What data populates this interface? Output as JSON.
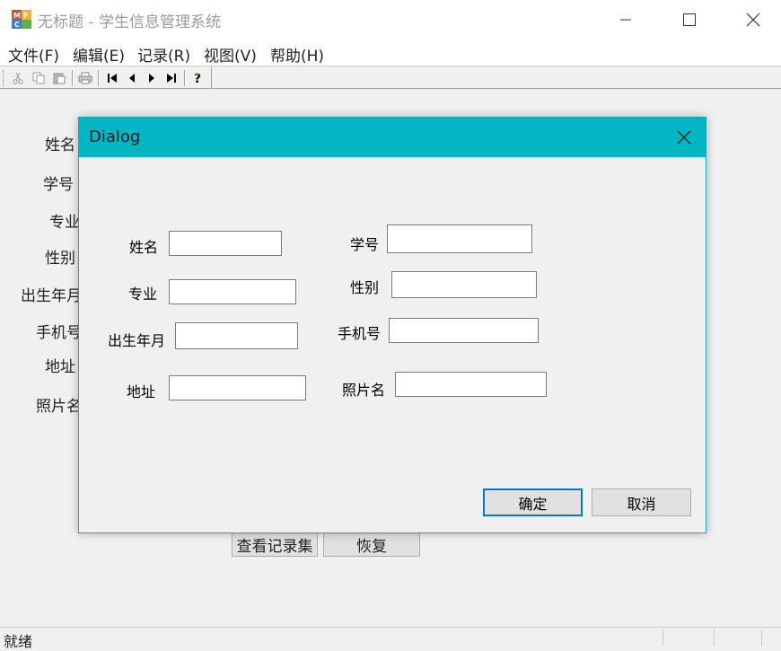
{
  "window": {
    "title": "无标题 - 学生信息管理系统",
    "icon": "mfc-app-icon"
  },
  "menu": {
    "items": [
      "文件(F)",
      "编辑(E)",
      "记录(R)",
      "视图(V)",
      "帮助(H)"
    ]
  },
  "toolbar": {
    "buttons": [
      "cut-icon",
      "copy-icon",
      "paste-icon",
      "print-icon",
      "first-record-icon",
      "prev-record-icon",
      "next-record-icon",
      "last-record-icon",
      "help-icon"
    ]
  },
  "main_form": {
    "labels": [
      "姓名",
      "学号",
      "专业",
      "性别",
      "出生年月",
      "手机号",
      "地址",
      "照片名"
    ],
    "view_records_button": "查看记录集",
    "restore_button": "恢复"
  },
  "status": {
    "text": "就绪"
  },
  "dialog": {
    "title": "Dialog",
    "fields": {
      "name": {
        "label": "姓名",
        "value": ""
      },
      "student_id": {
        "label": "学号",
        "value": ""
      },
      "major": {
        "label": "专业",
        "value": ""
      },
      "gender": {
        "label": "性别",
        "value": ""
      },
      "birth": {
        "label": "出生年月",
        "value": ""
      },
      "phone": {
        "label": "手机号",
        "value": ""
      },
      "address": {
        "label": "地址",
        "value": ""
      },
      "photo": {
        "label": "照片名",
        "value": ""
      }
    },
    "ok_button": "确定",
    "cancel_button": "取消"
  },
  "colors": {
    "dialog_titlebar": "#02b6c4",
    "default_button_border": "#0078d7"
  }
}
